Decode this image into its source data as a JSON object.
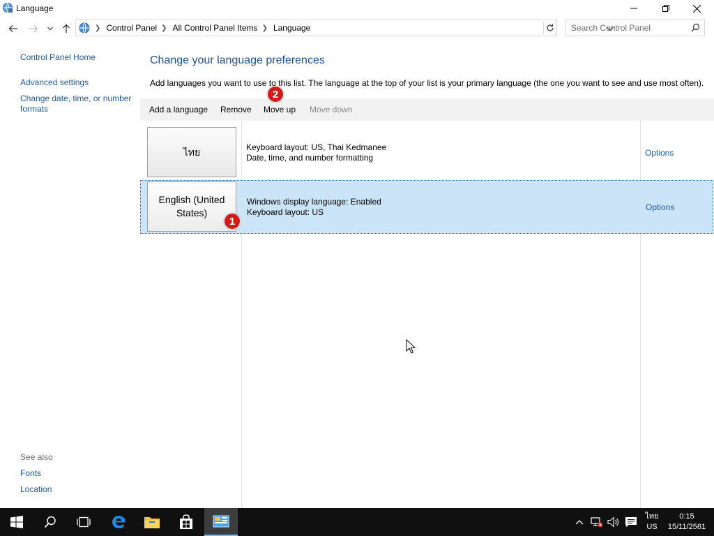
{
  "window": {
    "title": "Language",
    "minimize_label": "",
    "maximize_label": "",
    "close_label": ""
  },
  "address_bar": {
    "breadcrumbs": [
      "Control Panel",
      "All Control Panel Items",
      "Language"
    ],
    "search_placeholder": "Search Control Panel"
  },
  "sidebar": {
    "home": "Control Panel Home",
    "advanced_settings": "Advanced settings",
    "change_date": "Change date, time, or number formats",
    "see_also": "See also",
    "fonts": "Fonts",
    "location": "Location"
  },
  "main": {
    "heading": "Change your language preferences",
    "description": "Add languages you want to use to this list. The language at the top of your list is your primary language (the one you want to see and use most often).",
    "toolbar": {
      "add": "Add a language",
      "remove": "Remove",
      "move_up": "Move up",
      "move_down": "Move down"
    },
    "languages": [
      {
        "name": "ไทย",
        "line1": "Keyboard layout: US, Thai Kedmanee",
        "line2": "Date, time, and number formatting",
        "options": "Options",
        "selected": false
      },
      {
        "name": "English (United States)",
        "line1": "Windows display language: Enabled",
        "line2": "Keyboard layout: US",
        "options": "Options",
        "selected": true
      }
    ]
  },
  "annotations": {
    "badge1": "1",
    "badge2": "2",
    "badge_color": "#d11a1a"
  },
  "taskbar": {
    "ime_line1": "ไทย",
    "ime_line2": "US",
    "time": "0:15",
    "date": "15/11/2561"
  },
  "colors": {
    "link": "#1e5b9e",
    "heading": "#1e4f8f",
    "selection": "#cce4f7",
    "taskbar": "#101010"
  }
}
